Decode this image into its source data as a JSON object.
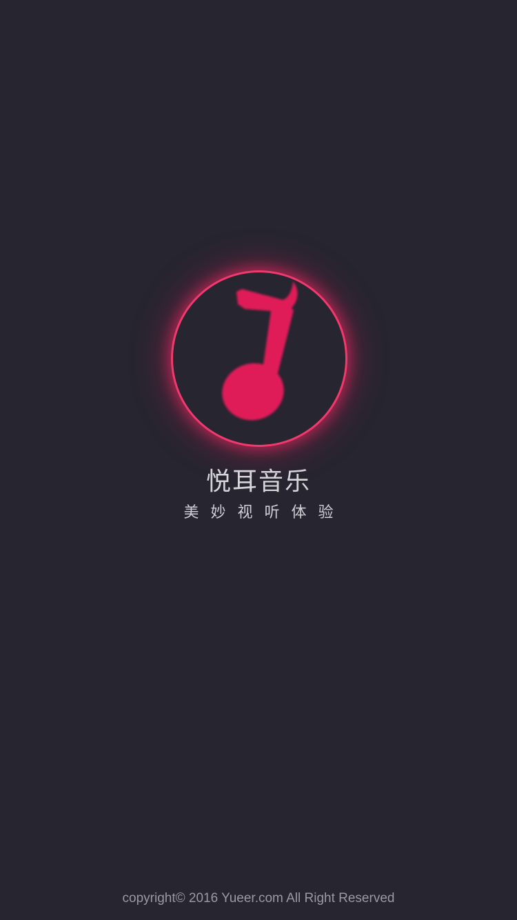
{
  "app": {
    "name": "悦耳音乐",
    "tagline": "美妙视听体验"
  },
  "logo": {
    "icon": "music-note-icon",
    "accent_color": "#e01a58",
    "ring_color": "#f03a6e"
  },
  "footer": {
    "copyright": "copyright© 2016 Yueer.com All Right Reserved"
  },
  "colors": {
    "background": "#262530"
  }
}
